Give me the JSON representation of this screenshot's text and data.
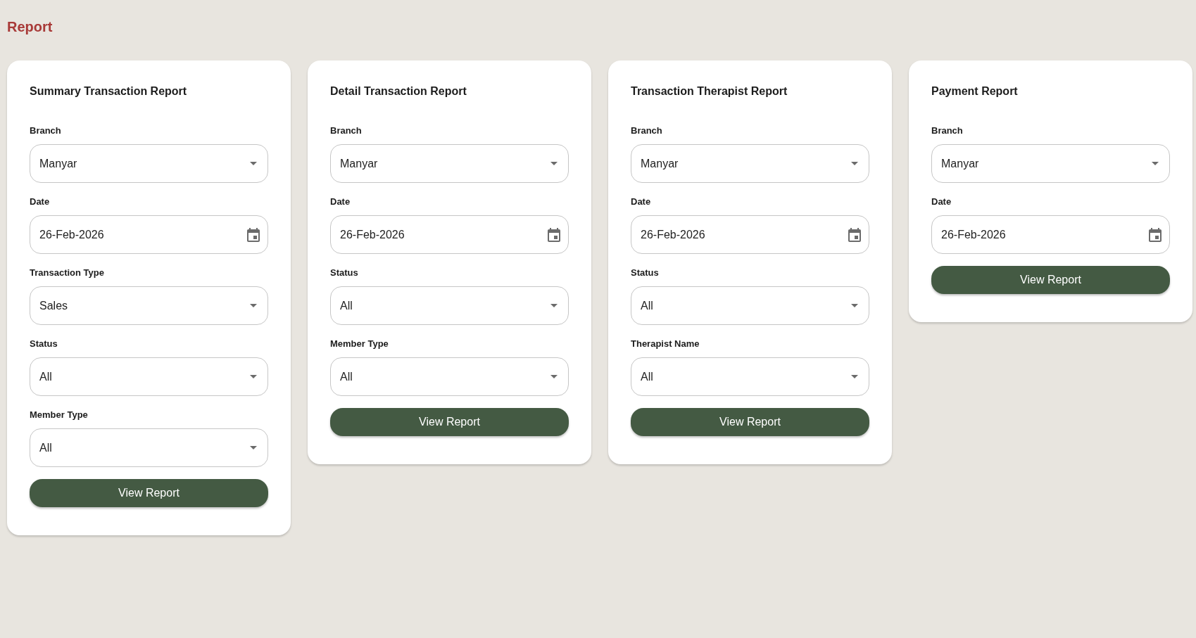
{
  "page": {
    "title": "Report"
  },
  "reports": [
    {
      "title": "Summary Transaction Report",
      "fields": [
        {
          "label": "Branch",
          "kind": "select",
          "value": "Manyar"
        },
        {
          "label": "Date",
          "kind": "date",
          "value": "26-Feb-2026"
        },
        {
          "label": "Transaction Type",
          "kind": "select",
          "value": "Sales"
        },
        {
          "label": "Status",
          "kind": "select",
          "value": "All"
        },
        {
          "label": "Member Type",
          "kind": "select",
          "value": "All"
        }
      ],
      "button": "View Report"
    },
    {
      "title": "Detail Transaction Report",
      "fields": [
        {
          "label": "Branch",
          "kind": "select",
          "value": "Manyar"
        },
        {
          "label": "Date",
          "kind": "date",
          "value": "26-Feb-2026"
        },
        {
          "label": "Status",
          "kind": "select",
          "value": "All"
        },
        {
          "label": "Member Type",
          "kind": "select",
          "value": "All"
        }
      ],
      "button": "View Report"
    },
    {
      "title": "Transaction Therapist Report",
      "fields": [
        {
          "label": "Branch",
          "kind": "select",
          "value": "Manyar"
        },
        {
          "label": "Date",
          "kind": "date",
          "value": "26-Feb-2026"
        },
        {
          "label": "Status",
          "kind": "select",
          "value": "All"
        },
        {
          "label": "Therapist Name",
          "kind": "select",
          "value": "All"
        }
      ],
      "button": "View Report"
    },
    {
      "title": "Payment Report",
      "fields": [
        {
          "label": "Branch",
          "kind": "select",
          "value": "Manyar"
        },
        {
          "label": "Date",
          "kind": "date",
          "value": "26-Feb-2026"
        }
      ],
      "button": "View Report"
    }
  ]
}
